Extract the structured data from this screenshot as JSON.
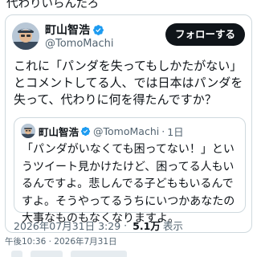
{
  "previous": {
    "text": "代わりいらんだろ"
  },
  "tweet": {
    "display_name": "町山智浩",
    "handle": "@TomoMachi",
    "follow_label": "フォローする",
    "text": "これに「パンダを失ってもしかたがない」とコメントしてる人、では日本はパンダを失って、代わりに何を得たんですか？",
    "quote": {
      "display_name": "町山智浩",
      "handle": "@TomoMachi",
      "separator": "·",
      "time": "1日",
      "text": "「パンダがいなくても困ってない！」というツイート見かけたけど、困ってる人もいるんですよ。悲しんでる子どももいるんですよ。そうやってるうちにいつかあなたの大事なものもなくなりますよ。"
    },
    "meta": {
      "timestamp": "2026年07月31日 3:29",
      "separator": "·",
      "views_count": "5.1万",
      "views_label": "表示"
    }
  },
  "footer": {
    "time": "午後10:36 · 2026年7月31日"
  },
  "colors": {
    "verified": "#1d9bf0",
    "secondary_text": "#536471",
    "follow_bg": "#0f1419"
  }
}
